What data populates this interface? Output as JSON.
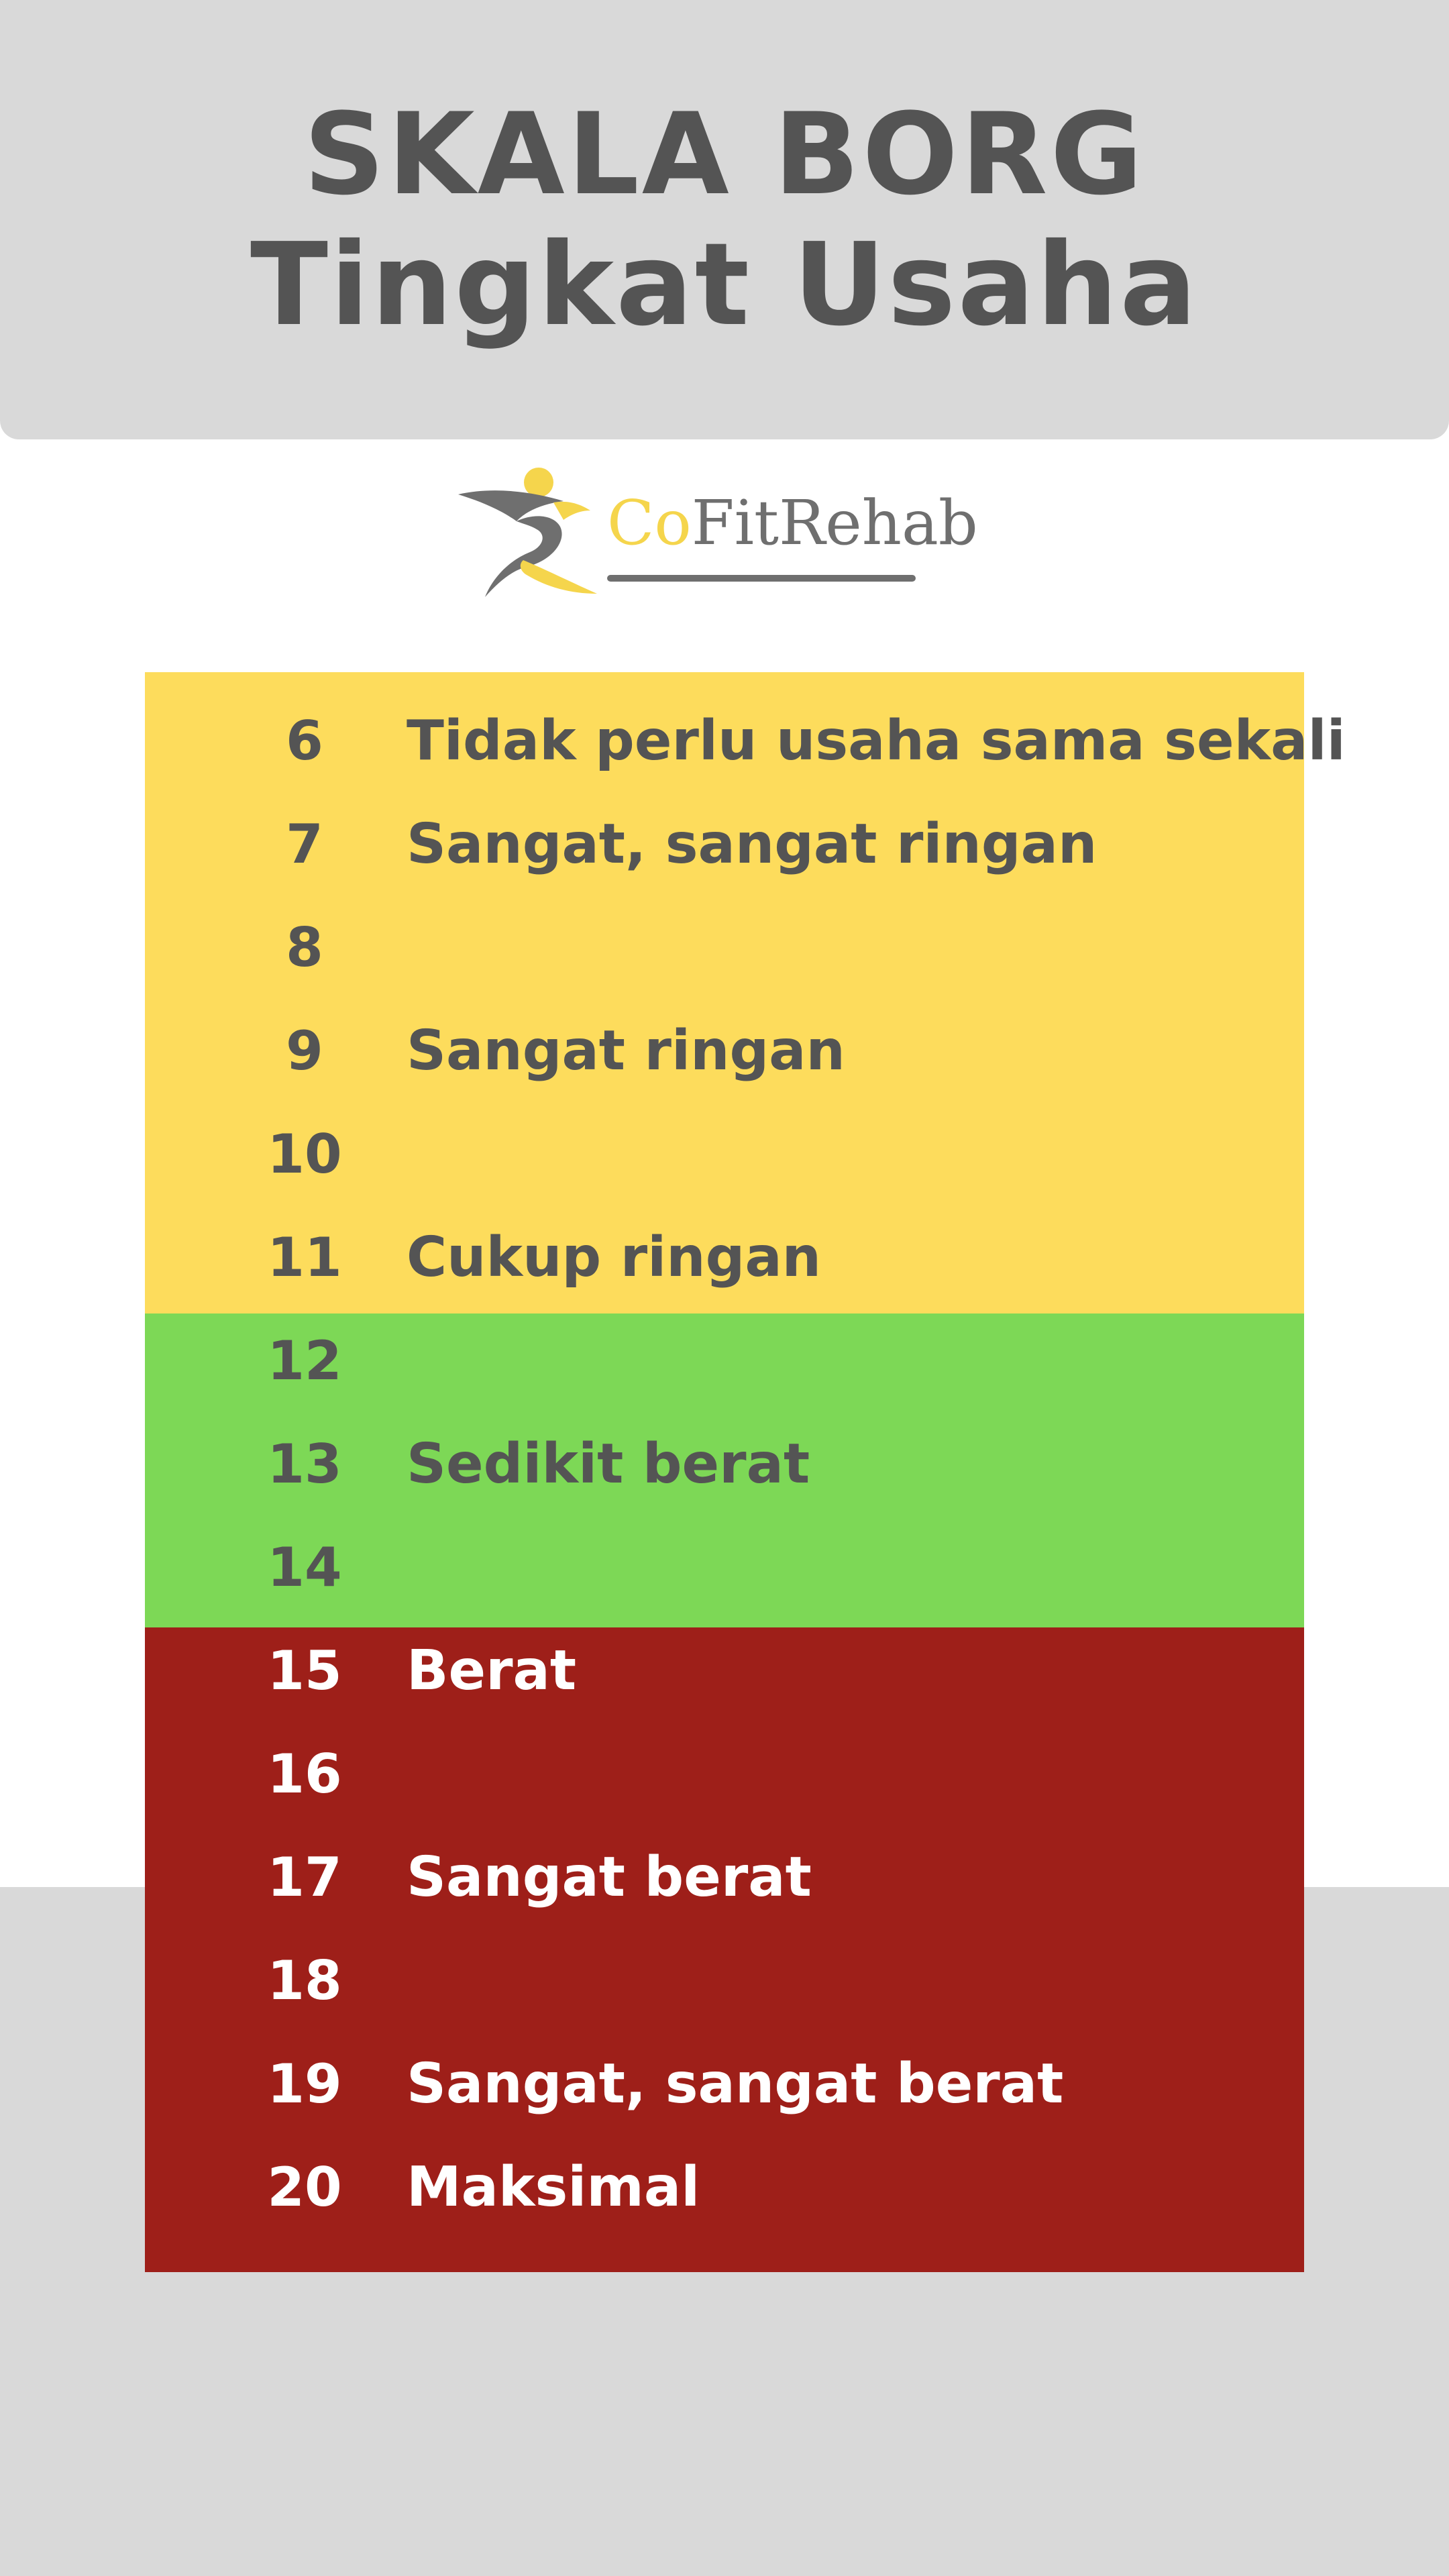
{
  "header": {
    "title_line1": "SKALA BORG",
    "title_line2": "Tingkat Usaha"
  },
  "logo": {
    "text_accent": "Co",
    "text_rest": "FitRehab",
    "mark_icon": "running-figure-icon",
    "accent_color": "#f5d54c",
    "dark_color": "#6f6f6f"
  },
  "scale": {
    "colors": {
      "yellow": "#fddc5c",
      "green": "#7dd856",
      "red": "#9e1f19",
      "text_dark": "#545454",
      "text_light": "#ffffff"
    },
    "rows": [
      {
        "value": "6",
        "label": "Tidak perlu usaha sama sekali",
        "zone": "yellow"
      },
      {
        "value": "7",
        "label": "Sangat, sangat ringan",
        "zone": "yellow"
      },
      {
        "value": "8",
        "label": "",
        "zone": "yellow"
      },
      {
        "value": "9",
        "label": "Sangat ringan",
        "zone": "yellow"
      },
      {
        "value": "10",
        "label": "",
        "zone": "yellow"
      },
      {
        "value": "11",
        "label": "Cukup ringan",
        "zone": "yellow"
      },
      {
        "value": "12",
        "label": "",
        "zone": "green"
      },
      {
        "value": "13",
        "label": "Sedikit berat",
        "zone": "green"
      },
      {
        "value": "14",
        "label": "",
        "zone": "green"
      },
      {
        "value": "15",
        "label": "Berat",
        "zone": "red"
      },
      {
        "value": "16",
        "label": "",
        "zone": "red"
      },
      {
        "value": "17",
        "label": "Sangat berat",
        "zone": "red"
      },
      {
        "value": "18",
        "label": "",
        "zone": "red"
      },
      {
        "value": "19",
        "label": "Sangat, sangat berat",
        "zone": "red"
      },
      {
        "value": "20",
        "label": "Maksimal",
        "zone": "red"
      }
    ]
  }
}
